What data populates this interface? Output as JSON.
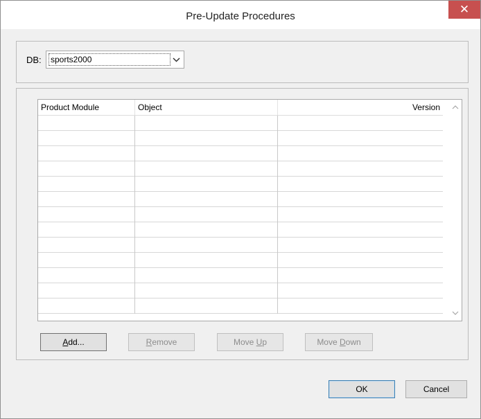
{
  "window": {
    "title": "Pre-Update Procedures",
    "close_glyph": "✕"
  },
  "db": {
    "label": "DB:",
    "selected": "sports2000",
    "arrow_icon": "chevron-down-icon"
  },
  "grid": {
    "columns": [
      "Product Module",
      "Object",
      "Version"
    ],
    "rows": [
      [
        "",
        "",
        ""
      ],
      [
        "",
        "",
        ""
      ],
      [
        "",
        "",
        ""
      ],
      [
        "",
        "",
        ""
      ],
      [
        "",
        "",
        ""
      ],
      [
        "",
        "",
        ""
      ],
      [
        "",
        "",
        ""
      ],
      [
        "",
        "",
        ""
      ],
      [
        "",
        "",
        ""
      ],
      [
        "",
        "",
        ""
      ],
      [
        "",
        "",
        ""
      ],
      [
        "",
        "",
        ""
      ],
      [
        "",
        "",
        ""
      ]
    ]
  },
  "buttons": {
    "add": {
      "pre": "",
      "mnemonic": "A",
      "post": "dd..."
    },
    "remove": {
      "pre": "",
      "mnemonic": "R",
      "post": "emove"
    },
    "move_up": {
      "pre": "Move ",
      "mnemonic": "U",
      "post": "p"
    },
    "move_down": {
      "pre": "Move ",
      "mnemonic": "D",
      "post": "own"
    },
    "ok": "OK",
    "cancel": "Cancel"
  },
  "colors": {
    "close_button": "#c7504f",
    "default_button_border": "#3c7fb1"
  }
}
